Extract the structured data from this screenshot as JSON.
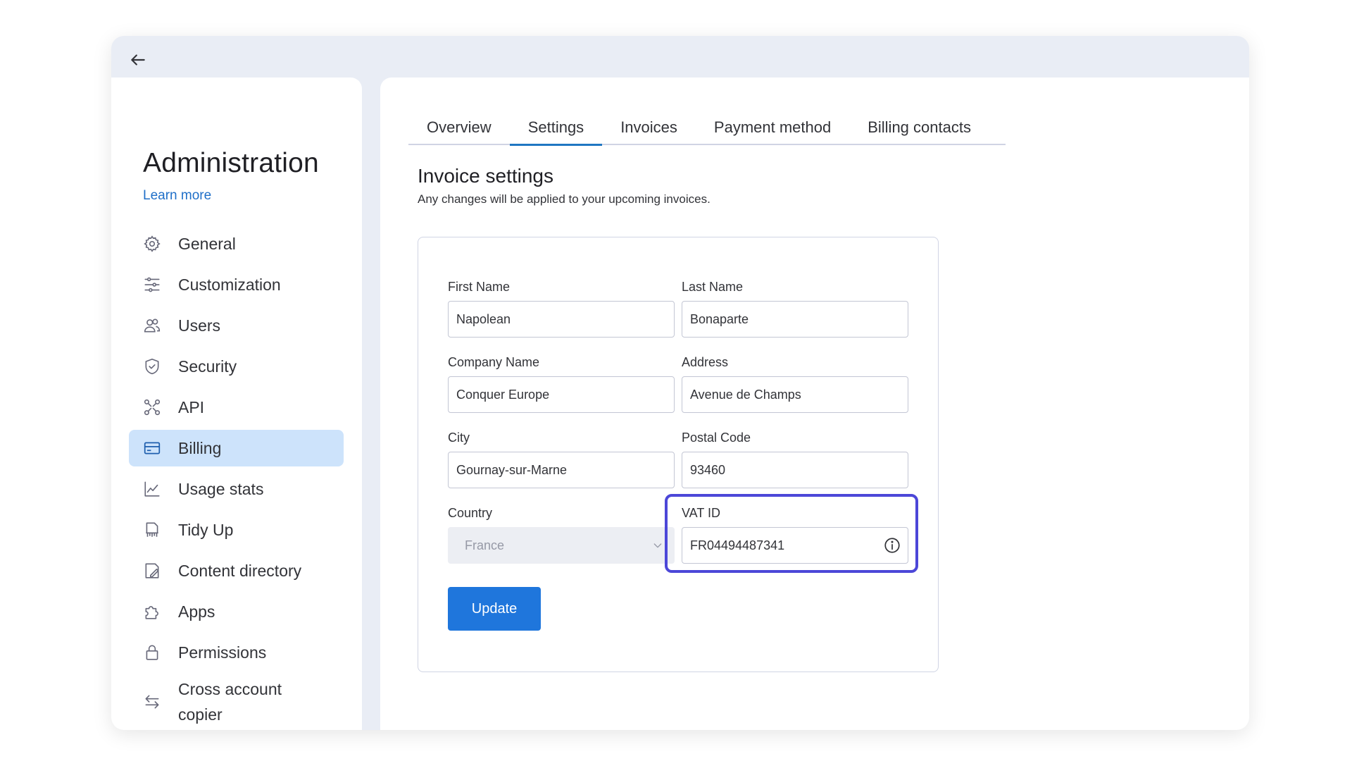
{
  "sidebar": {
    "title": "Administration",
    "learn_more": "Learn more",
    "items": [
      {
        "label": "General",
        "icon": "gear-icon"
      },
      {
        "label": "Customization",
        "icon": "sliders-icon"
      },
      {
        "label": "Users",
        "icon": "users-icon"
      },
      {
        "label": "Security",
        "icon": "shield-icon"
      },
      {
        "label": "API",
        "icon": "api-icon"
      },
      {
        "label": "Billing",
        "icon": "credit-card-icon",
        "active": true
      },
      {
        "label": "Usage stats",
        "icon": "chart-icon"
      },
      {
        "label": "Tidy Up",
        "icon": "tidy-icon"
      },
      {
        "label": "Content directory",
        "icon": "document-icon"
      },
      {
        "label": "Apps",
        "icon": "puzzle-icon"
      },
      {
        "label": "Permissions",
        "icon": "lock-icon"
      },
      {
        "label": "Cross account copier",
        "icon": "arrows-swap-icon"
      }
    ]
  },
  "tabs": [
    {
      "label": "Overview"
    },
    {
      "label": "Settings",
      "active": true
    },
    {
      "label": "Invoices"
    },
    {
      "label": "Payment method"
    },
    {
      "label": "Billing contacts"
    }
  ],
  "invoice_settings": {
    "title": "Invoice settings",
    "subtitle": "Any changes will be applied to your upcoming invoices.",
    "fields": {
      "first_name": {
        "label": "First Name",
        "value": "Napolean"
      },
      "last_name": {
        "label": "Last Name",
        "value": "Bonaparte"
      },
      "company_name": {
        "label": "Company Name",
        "value": "Conquer Europe"
      },
      "address": {
        "label": "Address",
        "value": "Avenue de Champs"
      },
      "city": {
        "label": "City",
        "value": "Gournay-sur-Marne"
      },
      "postal_code": {
        "label": "Postal Code",
        "value": "93460"
      },
      "country": {
        "label": "Country",
        "value": "France"
      },
      "vat_id": {
        "label": "VAT ID",
        "value": "FR04494487341"
      }
    },
    "update_label": "Update"
  },
  "colors": {
    "accent": "#1f76dc",
    "active_nav_bg": "#cde3fb",
    "highlight": "#4c47d8",
    "window_bg": "#e9edf5"
  }
}
